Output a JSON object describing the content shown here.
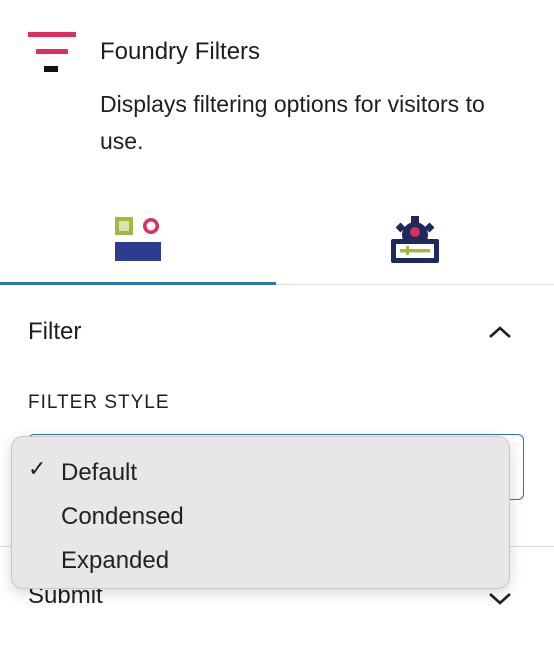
{
  "block": {
    "icon": "filter-icon",
    "title": "Foundry Filters",
    "description": "Displays filtering options for visitors to use."
  },
  "tabs": [
    {
      "icon": "styles-icon",
      "active": true
    },
    {
      "icon": "settings-gear-icon",
      "active": false
    }
  ],
  "colors": {
    "accent_blue": "#3172b6",
    "icon_red": "#dc2f5e",
    "icon_navy": "#1e2a5c",
    "icon_green": "#a3b844"
  },
  "filter_panel": {
    "title": "Filter",
    "expanded": true,
    "field_label": "FILTER STYLE",
    "select": {
      "selected": "Default",
      "options": [
        "Default",
        "Condensed",
        "Expanded"
      ]
    }
  },
  "submit_panel": {
    "title": "Submit",
    "expanded": false
  }
}
